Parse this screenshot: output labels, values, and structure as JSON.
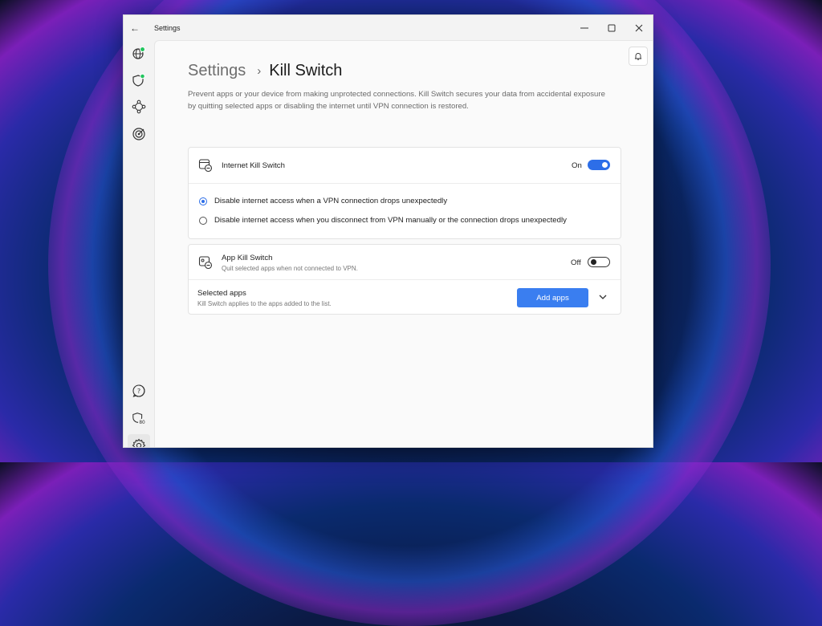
{
  "window": {
    "title": "Settings",
    "controls": [
      "minimize-icon",
      "maximize-icon",
      "close-icon"
    ]
  },
  "sidebar": {
    "top_items": [
      {
        "icon": "globe-status-icon"
      },
      {
        "icon": "shield-status-icon"
      },
      {
        "icon": "meshnet-icon"
      },
      {
        "icon": "target-icon"
      }
    ],
    "bottom_items": [
      {
        "icon": "help-icon"
      },
      {
        "icon": "shield-score-icon",
        "badge": "80"
      },
      {
        "icon": "gear-icon",
        "active": true
      }
    ]
  },
  "header": {
    "breadcrumb_root": "Settings",
    "breadcrumb_separator": "›",
    "page_title": "Kill Switch"
  },
  "description": "Prevent apps or your device from making unprotected connections. Kill Switch secures your data from accidental exposure by quitting selected apps or disabling the internet until VPN connection is restored.",
  "internet_kill_switch": {
    "title": "Internet Kill Switch",
    "state_label": "On",
    "enabled": true,
    "options": [
      {
        "label": "Disable internet access when a VPN connection drops unexpectedly",
        "selected": true
      },
      {
        "label": "Disable internet access when you disconnect from VPN manually or the connection drops unexpectedly",
        "selected": false
      }
    ]
  },
  "app_kill_switch": {
    "title": "App Kill Switch",
    "subtitle": "Quit selected apps when not connected to VPN.",
    "state_label": "Off",
    "enabled": false,
    "selected_apps": {
      "title": "Selected apps",
      "subtitle": "Kill Switch applies to the apps added to the list.",
      "add_button": "Add apps"
    }
  },
  "colors": {
    "accent": "#2d6ee8",
    "button": "#3a7ef0",
    "status_green": "#22c55e"
  }
}
